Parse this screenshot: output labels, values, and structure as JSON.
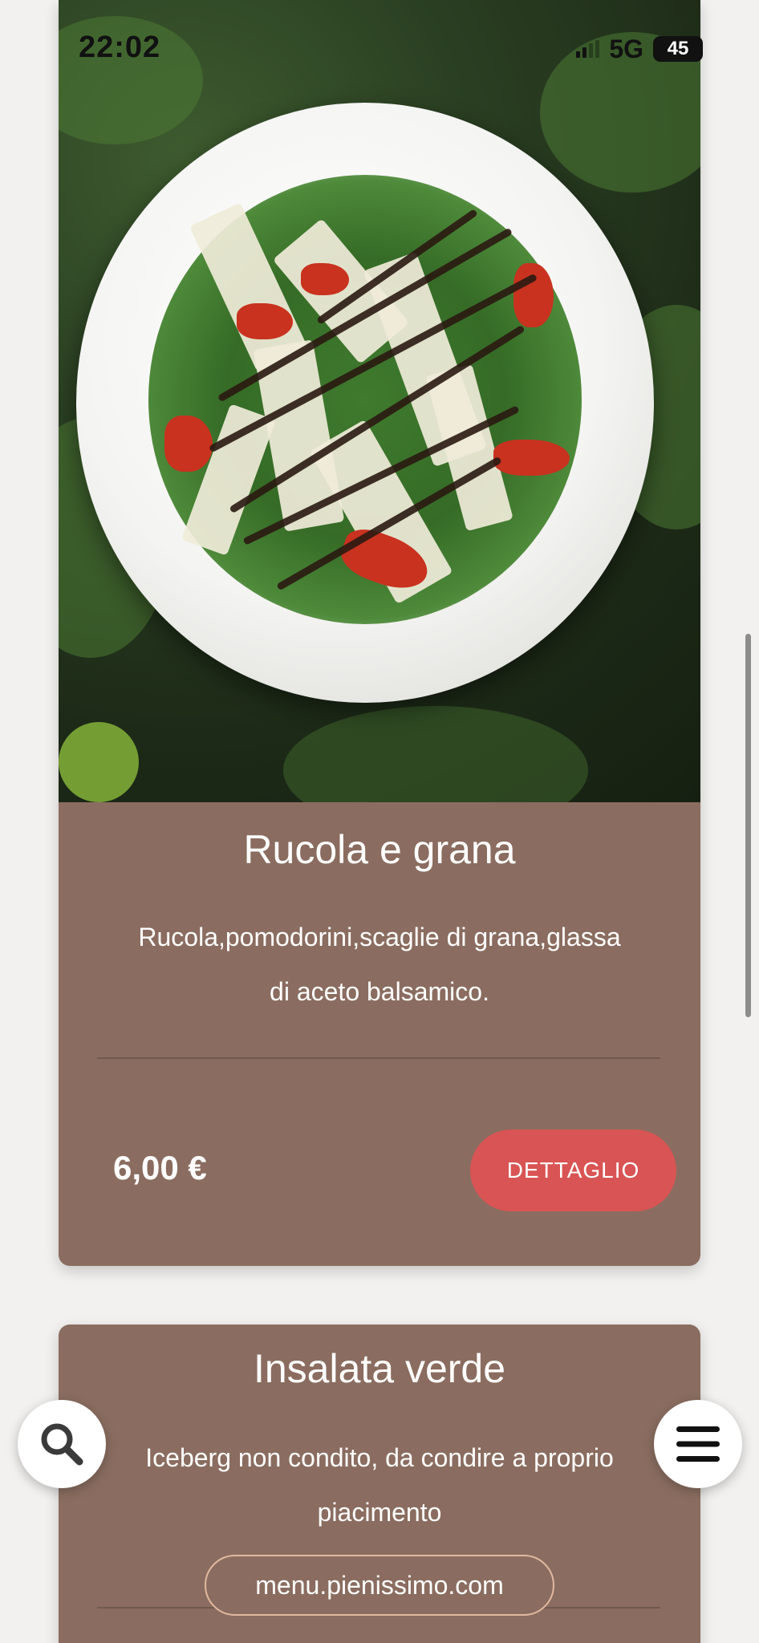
{
  "status_bar": {
    "time": "22:02",
    "network": "5G",
    "battery": "45"
  },
  "cards": [
    {
      "title": "Rucola e grana",
      "description_line1": "Rucola,pomodorini,scaglie di grana,glassa",
      "description_line2": "di aceto balsamico.",
      "price": "6,00 €",
      "button_label": "DETTAGLIO",
      "image": "salad-plate-photo"
    },
    {
      "title": "Insalata verde",
      "description_line1": "Iceberg non condito, da condire a proprio",
      "description_line2": "piacimento"
    }
  ],
  "footer": {
    "url": "menu.pienissimo.com"
  },
  "icons": {
    "search": "search-icon",
    "menu": "hamburger-menu-icon"
  },
  "colors": {
    "card_bg": "#8a6d60",
    "button_bg": "#d95454",
    "page_bg": "#f2f1ef",
    "pill_border": "#e2b99f"
  }
}
